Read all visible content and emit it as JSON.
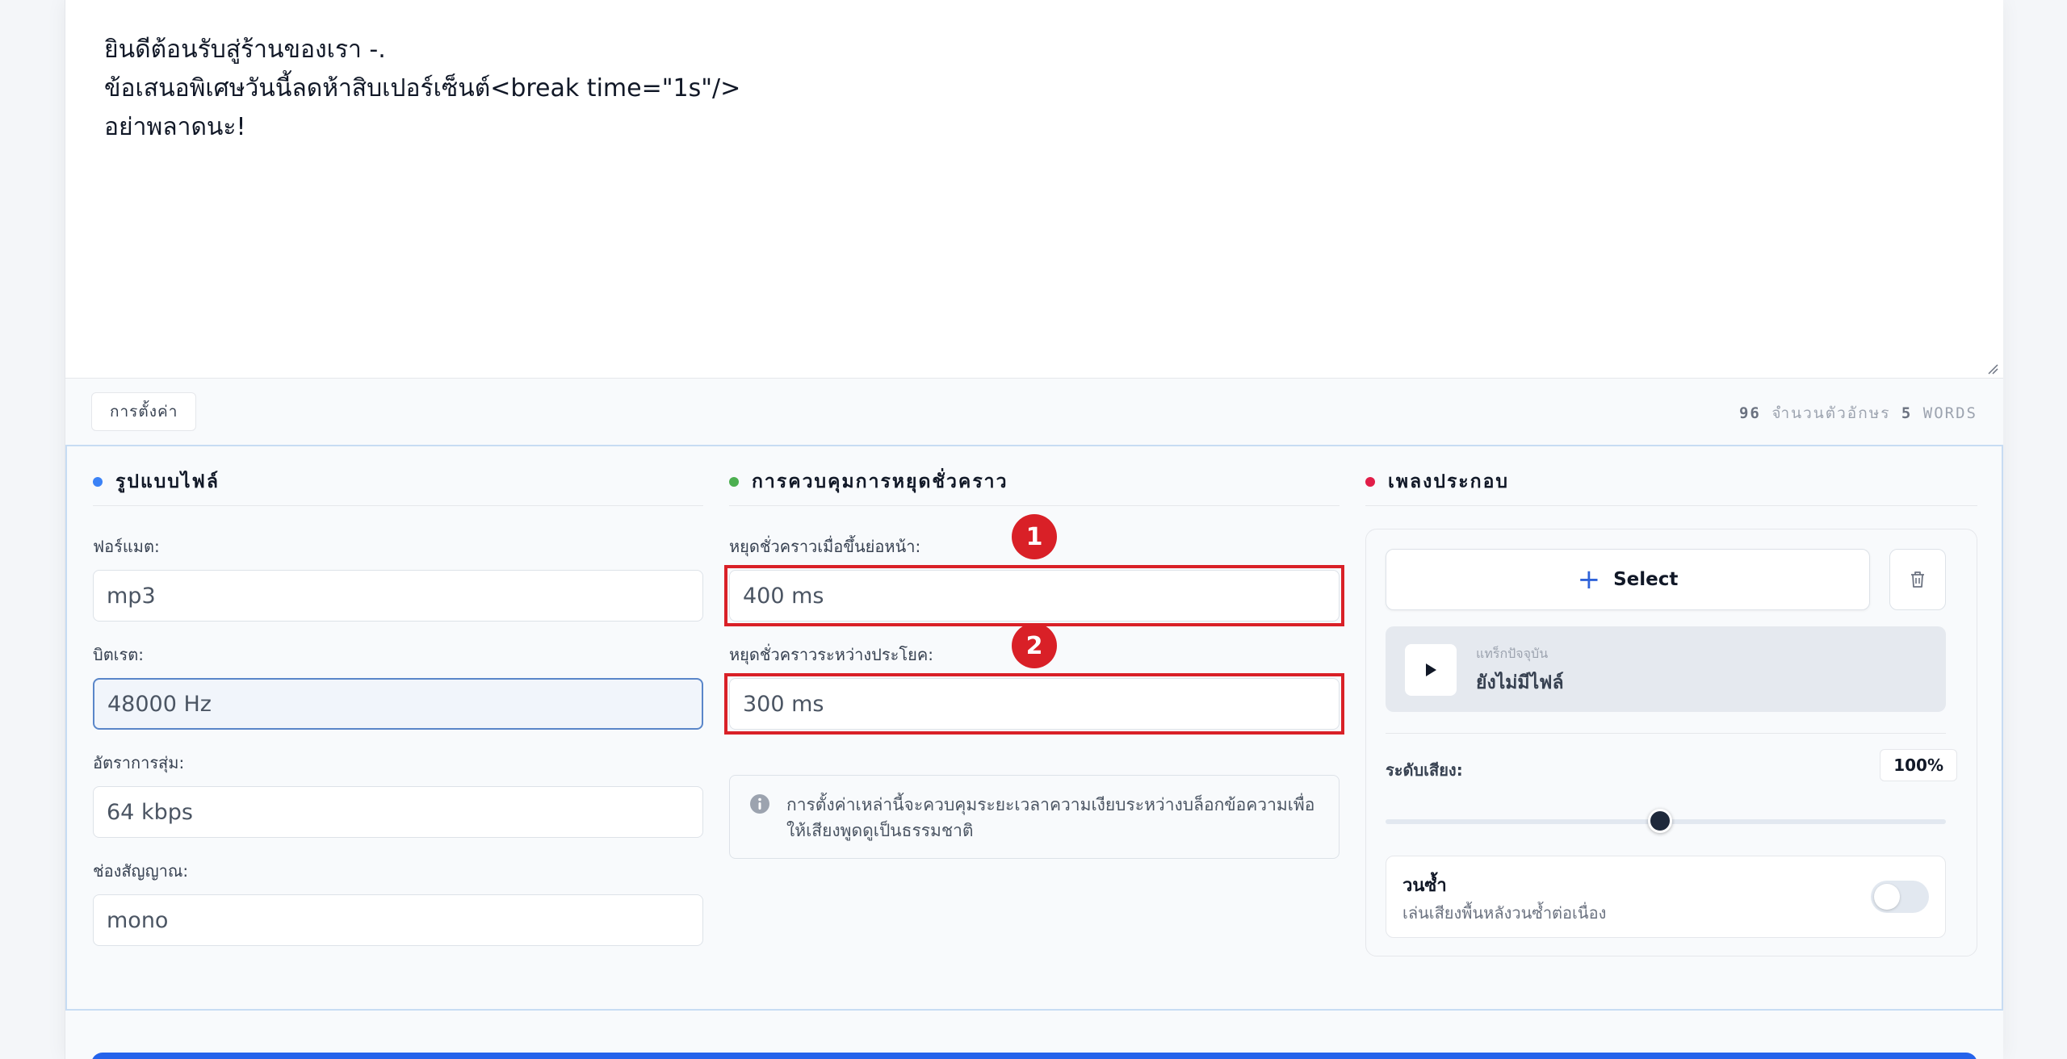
{
  "editor": {
    "text": "ยินดีต้อนรับสู่ร้านของเรา -.\nข้อเสนอพิเศษวันนี้ลดห้าสิบเปอร์เซ็นต์<break time=\"1s\"/>\nอย่าพลาดนะ!"
  },
  "toolbar": {
    "settings_label": "การตั้งค่า",
    "char_count": "96",
    "char_label": "จำนวนตัวอักษร",
    "word_count": "5",
    "word_label": "WORDS"
  },
  "file_format": {
    "title": "รูปแบบไฟล์",
    "dot_color": "#3b82f6",
    "format_label": "ฟอร์แมต:",
    "format_value": "mp3",
    "bitrate_label": "บิตเรต:",
    "bitrate_value": "48000 Hz",
    "sample_rate_label": "อัตราการสุ่ม:",
    "sample_rate_value": "64 kbps",
    "channel_label": "ช่องสัญญาณ:",
    "channel_value": "mono"
  },
  "pause_control": {
    "title": "การควบคุมการหยุดชั่วคราว",
    "dot_color": "#4caf50",
    "paragraph_label": "หยุดชั่วคราวเมื่อขึ้นย่อหน้า:",
    "paragraph_value": "400 ms",
    "sentence_label": "หยุดชั่วคราวระหว่างประโยค:",
    "sentence_value": "300 ms",
    "info_text": "การตั้งค่าเหล่านี้จะควบคุมระยะเวลาความเงียบระหว่างบล็อกข้อความเพื่อให้เสียงพูดดูเป็นธรรมชาติ",
    "badge_1": "1",
    "badge_2": "2",
    "highlight_color": "#d92027"
  },
  "background_music": {
    "title": "เพลงประกอบ",
    "dot_color": "#e11d48",
    "select_label": "Select",
    "current_track_caption": "แทร็กปัจจุบัน",
    "current_track_name": "ยังไม่มีไฟล์",
    "volume_label": "ระดับเสียง:",
    "volume_value": "100%",
    "volume_level": 0.49,
    "loop_title": "วนซ้ำ",
    "loop_subtitle": "เล่นเสียงพื้นหลังวนซ้ำต่อเนื่อง",
    "loop_enabled": false
  }
}
